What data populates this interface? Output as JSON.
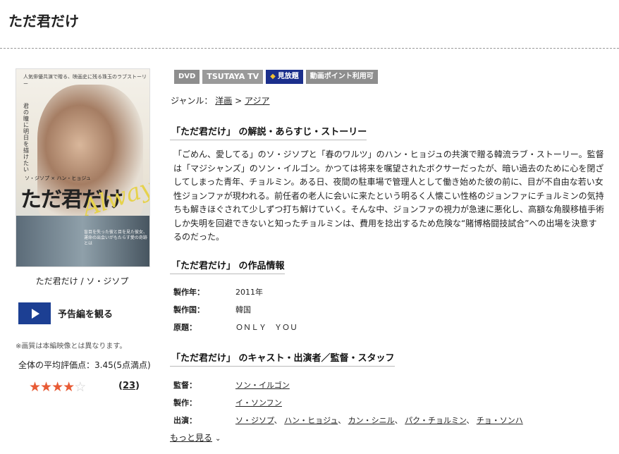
{
  "page": {
    "title": "ただ君だけ"
  },
  "poster": {
    "alt": "ただ君だけ",
    "tagline": "人気俳優共演で贈る、映画史に残る珠玉のラブストーリー",
    "vertical_text": "君の瞳に明日を描けたい",
    "actors_line": "ソ・ジソプ × ハン・ヒョジュ",
    "title_text": "ただ君だけ",
    "accent_text": "Always",
    "bottom_text": "盲目を失った彼と目を見た彼女、運命の出会いがもたらす愛の奇跡とは"
  },
  "poster_caption": "ただ君だけ / ソ・ジソプ",
  "trailer": {
    "label": "予告編を観る"
  },
  "note": "※画質は本編映像とは異なります。",
  "rating": {
    "average_text": "全体の平均評価点：3.45(5点満点)",
    "value": 3.45,
    "max": 5,
    "stars": [
      "★",
      "★",
      "★",
      "★",
      "☆"
    ],
    "count_open": "(",
    "count": "23",
    "count_close": ")"
  },
  "badges": {
    "dvd": "DVD",
    "tsutaya": "TSUTAYA TV",
    "mihodai": "見放題",
    "points": "動画ポイント利用可"
  },
  "genre": {
    "label": "ジャンル：",
    "cat1": "洋画",
    "sep": ">",
    "cat2": "アジア"
  },
  "sections": {
    "synopsis_title": "「ただ君だけ」 の解説・あらすじ・ストーリー",
    "info_title": "「ただ君だけ」 の作品情報",
    "cast_title": "「ただ君だけ」 のキャスト・出演者／監督・スタッフ"
  },
  "synopsis": "「ごめん、愛してる」のソ・ジソプと「春のワルツ」のハン・ヒョジュの共演で贈る韓流ラブ・ストーリー。監督は「マジシャンズ」のソン・イルゴン。かつては将来を嘱望されたボクサーだったが、暗い過去のために心を閉ざしてしまった青年、チョルミン。ある日、夜間の駐車場で管理人として働き始めた彼の前に、目が不自由な若い女性ジョンファが現われる。前任者の老人に会いに来たという明るく人懐こい性格のジョンファにチョルミンの気持ちも解きほぐされて少しずつ打ち解けていく。そんな中、ジョンファの視力が急速に悪化し、高額な角膜移植手術しか失明を回避できないと知ったチョルミンは、費用を捻出するため危険な“賭博格闘技試合”への出場を決意するのだった。",
  "info": {
    "year_label": "製作年：",
    "year": "2011年",
    "country_label": "製作国：",
    "country": "韓国",
    "original_label": "原題：",
    "original": "ＯＮＬＹ　ＹＯＵ"
  },
  "staff": {
    "director_label": "監督：",
    "director": "ソン・イルゴン",
    "producer_label": "製作：",
    "producer": "イ・ソンフン",
    "cast_label": "出演：",
    "cast": [
      "ソ・ジソプ",
      "ハン・ヒョジュ",
      "カン・シニル",
      "パク・チョルミン",
      "チョ・ソンハ"
    ],
    "cast_sep": "、"
  },
  "more": {
    "label": "もっと見る"
  },
  "colors": {
    "accent_blue": "#1c3f93",
    "star": "#e85b35",
    "badge_gray": "#8e8e8e"
  }
}
